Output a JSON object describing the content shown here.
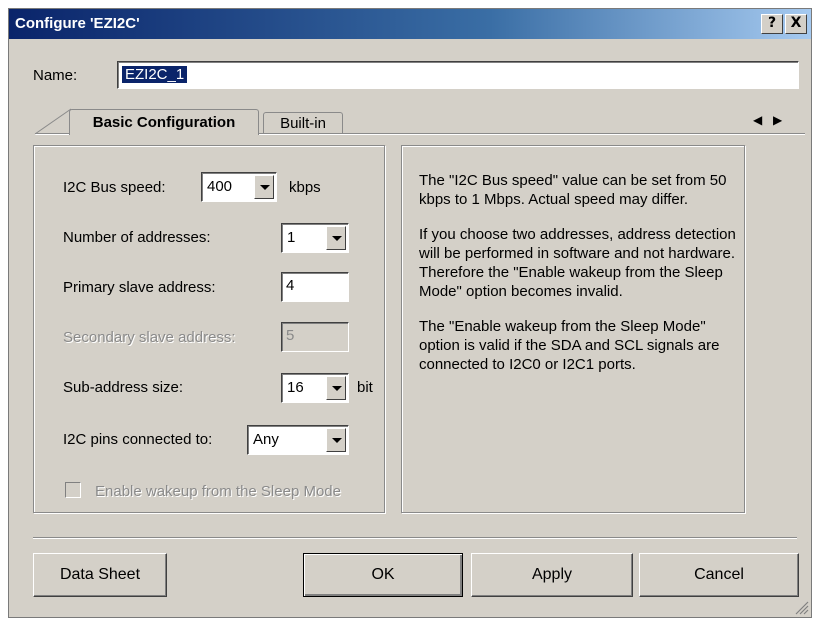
{
  "window": {
    "title": "Configure 'EZI2C'",
    "help_button": "?",
    "close_button": "X"
  },
  "name_field": {
    "label": "Name:",
    "value": "EZI2C_1"
  },
  "tabs": [
    {
      "label": "Basic Configuration",
      "active": true
    },
    {
      "label": "Built-in",
      "active": false
    }
  ],
  "settings": {
    "bus_speed": {
      "label": "I2C Bus speed:",
      "value": "400",
      "unit": "kbps"
    },
    "num_addresses": {
      "label": "Number of addresses:",
      "value": "1"
    },
    "primary_address": {
      "label": "Primary slave address:",
      "value": "4"
    },
    "secondary_address": {
      "label": "Secondary slave address:",
      "value": "5",
      "enabled": false
    },
    "subaddress_size": {
      "label": "Sub-address size:",
      "value": "16",
      "unit": "bit"
    },
    "pins": {
      "label": "I2C pins connected to:",
      "value": "Any"
    },
    "wakeup": {
      "label": "Enable wakeup from the Sleep Mode",
      "checked": false,
      "enabled": false
    }
  },
  "description": {
    "paragraphs": [
      "The \"I2C Bus speed\" value can be set from 50 kbps to 1 Mbps. Actual speed may differ.",
      "If you choose two addresses, address detection will be performed in software and not hardware. Therefore the \"Enable wakeup from the Sleep Mode\" option becomes invalid.",
      "The \"Enable wakeup from the Sleep Mode\" option is valid if the SDA and SCL signals are connected to I2C0 or I2C1 ports."
    ]
  },
  "buttons": {
    "datasheet": "Data Sheet",
    "ok": "OK",
    "apply": "Apply",
    "cancel": "Cancel"
  },
  "colors": {
    "dialog_bg": "#d4d0c8",
    "titlebar_start": "#0a246a",
    "titlebar_end": "#a6caf0",
    "selection": "#0a246a"
  }
}
